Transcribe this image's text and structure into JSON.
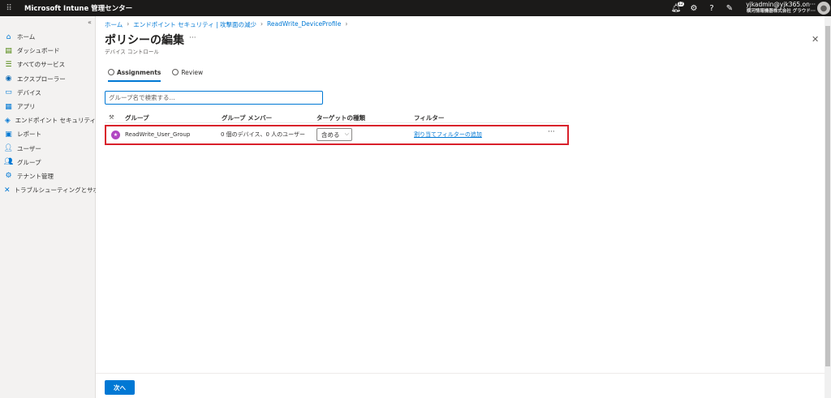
{
  "topbar": {
    "app_title": "Microsoft Intune 管理センター",
    "notification_count": "12",
    "user_email": "yjkadmin@yjk365.on···",
    "user_org": "横河情報機器株式会社 グラウド···"
  },
  "sidebar": {
    "items": [
      {
        "label": "ホーム",
        "icon": "home-icon"
      },
      {
        "label": "ダッシュボード",
        "icon": "dashboard-icon"
      },
      {
        "label": "すべてのサービス",
        "icon": "list-icon"
      },
      {
        "label": "エクスプローラー",
        "icon": "explorer-icon"
      },
      {
        "label": "デバイス",
        "icon": "devices-icon"
      },
      {
        "label": "アプリ",
        "icon": "apps-icon"
      },
      {
        "label": "エンドポイント セキュリティ",
        "icon": "shield-icon"
      },
      {
        "label": "レポート",
        "icon": "reports-icon"
      },
      {
        "label": "ユーザー",
        "icon": "user-icon"
      },
      {
        "label": "グループ",
        "icon": "group-icon"
      },
      {
        "label": "テナント管理",
        "icon": "tenant-icon"
      },
      {
        "label": "トラブルシューティングとサポート",
        "icon": "tools-icon"
      }
    ]
  },
  "breadcrumb": [
    "ホーム",
    "エンドポイント セキュリティ | 攻撃面の減少",
    "ReadWrite_DeviceProfile"
  ],
  "page": {
    "title": "ポリシーの編集",
    "subtitle": "デバイス コントロール"
  },
  "tabs": [
    {
      "label": "Assignments",
      "active": true
    },
    {
      "label": "Review",
      "active": false
    }
  ],
  "search": {
    "placeholder": "グループ名で検索する..."
  },
  "table": {
    "headers": [
      "グループ",
      "グループ メンバー",
      "ターゲットの種類",
      "フィルター"
    ],
    "rows": [
      {
        "group": "ReadWrite_User_Group",
        "members": "0 個のデバイス、0 人のユーザー",
        "target": "含める",
        "filter": "割り当てフィルターの追加"
      }
    ]
  },
  "footer": {
    "next_label": "次へ"
  },
  "colors": {
    "accent": "#0078d4",
    "highlight": "#d9202b",
    "group_avatar": "#b146c2"
  }
}
